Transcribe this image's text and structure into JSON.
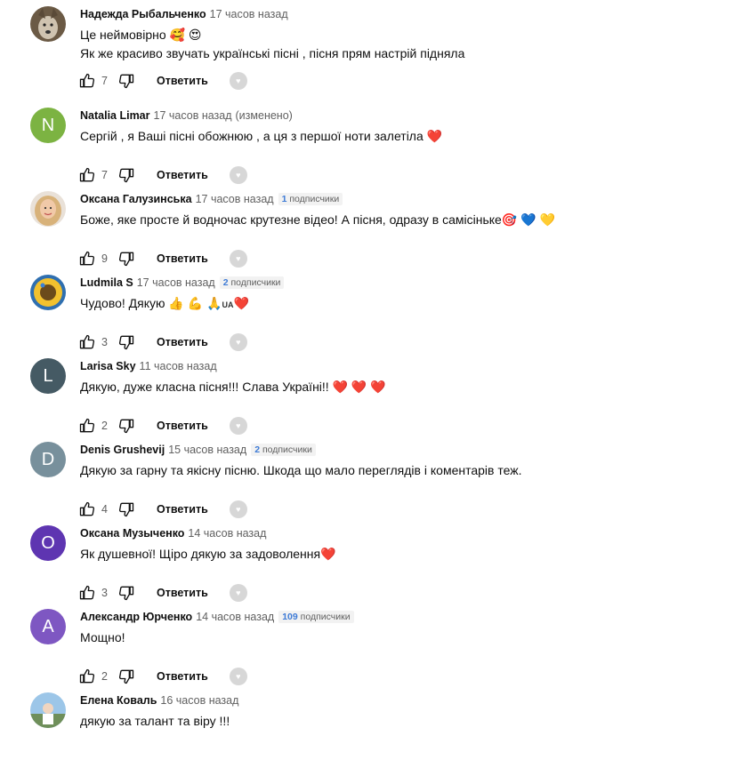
{
  "reply_label": "Ответить",
  "comments": [
    {
      "author": "Надежда Рыбальченко",
      "time": "17 часов назад",
      "text_lines": [
        "Це неймовірно 🥰 😍",
        "Як же красиво звучать українські пісні , пісня прям настрій підняла"
      ],
      "likes": "7",
      "avatar_type": "photo-dog"
    },
    {
      "author": "Natalia Limar",
      "time": "17 часов назад",
      "edited": "(изменено)",
      "text_lines": [
        "Сергій , я Ваші пісні обожнюю , а ця з першої ноти залетіла ❤️"
      ],
      "likes": "7",
      "avatar_type": "letter",
      "avatar_letter": "N",
      "avatar_color": "#7cb342"
    },
    {
      "author": "Оксана Галузинська",
      "time": "17 часов назад",
      "subs_count": "1",
      "subs_label": "подписчики",
      "text_lines": [
        "Боже, яке просте й водночас крутезне відео! А пісня, одразу в самісіньке🎯 💙 💛"
      ],
      "likes": "9",
      "avatar_type": "photo-woman"
    },
    {
      "author": "Ludmila S",
      "time": "17 часов назад",
      "subs_count": "2",
      "subs_label": "подписчики",
      "text_lines": [
        "Чудово! Дякую 👍 💪 🙏"
      ],
      "flag_text": "UA",
      "flag_tail": "❤️",
      "likes": "3",
      "avatar_type": "photo-sunflower"
    },
    {
      "author": "Larisa Sky",
      "time": "11 часов назад",
      "text_lines": [
        "Дякую, дуже класна пісня!!! Слава Україні!! ❤️ ❤️ ❤️"
      ],
      "likes": "2",
      "avatar_type": "letter",
      "avatar_letter": "L",
      "avatar_color": "#455a64"
    },
    {
      "author": "Denis Grushevij",
      "time": "15 часов назад",
      "subs_count": "2",
      "subs_label": "подписчики",
      "text_lines": [
        "Дякую за гарну та якісну пісню. Шкода що  мало переглядів і коментарів теж."
      ],
      "likes": "4",
      "avatar_type": "letter",
      "avatar_letter": "D",
      "avatar_color": "#78909c"
    },
    {
      "author": "Оксана Музыченко",
      "time": "14 часов назад",
      "text_lines": [
        "Як душевної! Щіро дякую за задоволення❤️"
      ],
      "likes": "3",
      "avatar_type": "letter",
      "avatar_letter": "О",
      "avatar_color": "#5e35b1"
    },
    {
      "author": "Александр Юрченко",
      "time": "14 часов назад",
      "subs_count": "109",
      "subs_label": "подписчики",
      "text_lines": [
        "Мощно!"
      ],
      "likes": "2",
      "avatar_type": "letter",
      "avatar_letter": "A",
      "avatar_color": "#7e57c2"
    },
    {
      "author": "Елена Коваль",
      "time": "16 часов назад",
      "text_lines": [
        "дякую за талант та віру !!!"
      ],
      "likes": "",
      "avatar_type": "photo-landscape"
    }
  ]
}
